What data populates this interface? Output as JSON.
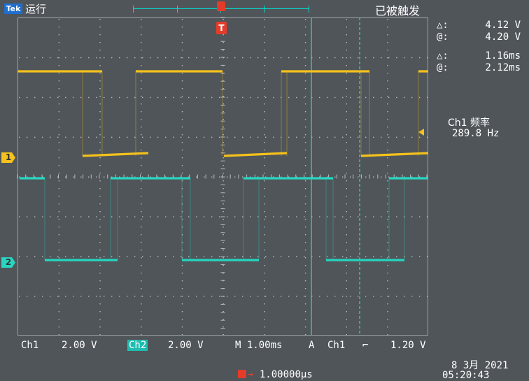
{
  "header": {
    "brand": "Tek",
    "run_status": "运行",
    "trigger_status": "已被触发",
    "trigger_position_marker": "T"
  },
  "cursor_readout": {
    "voltage": {
      "delta_symbol": "△:",
      "delta_value": "4.12 V",
      "at_symbol": "@:",
      "at_value": "4.20 V"
    },
    "time": {
      "delta_symbol": "△:",
      "delta_value": "1.16ms",
      "at_symbol": "@:",
      "at_value": "2.12ms"
    }
  },
  "measurement": {
    "label": "Ch1 频率",
    "value": "289.8 Hz"
  },
  "channel_markers": {
    "ch1": "1",
    "ch2": "2"
  },
  "footer": {
    "ch1_label": "Ch1",
    "ch1_scale": "2.00 V",
    "ch2_label": "Ch2",
    "ch2_scale": "2.00 V",
    "timebase": "M 1.00ms",
    "trigger_mode": "A",
    "trigger_source": "Ch1",
    "trigger_slope_symbol": "⌐",
    "trigger_level": "1.20 V",
    "horizontal_position": "1.00000µs",
    "date": "8 3月  2021",
    "time": "05:20:43"
  },
  "colors": {
    "ch1": "#f5c21b",
    "ch2": "#26d6c0",
    "screen_bg": "#50555a",
    "grid": "#b8bcbf",
    "accent_red": "#e43b2a"
  }
}
